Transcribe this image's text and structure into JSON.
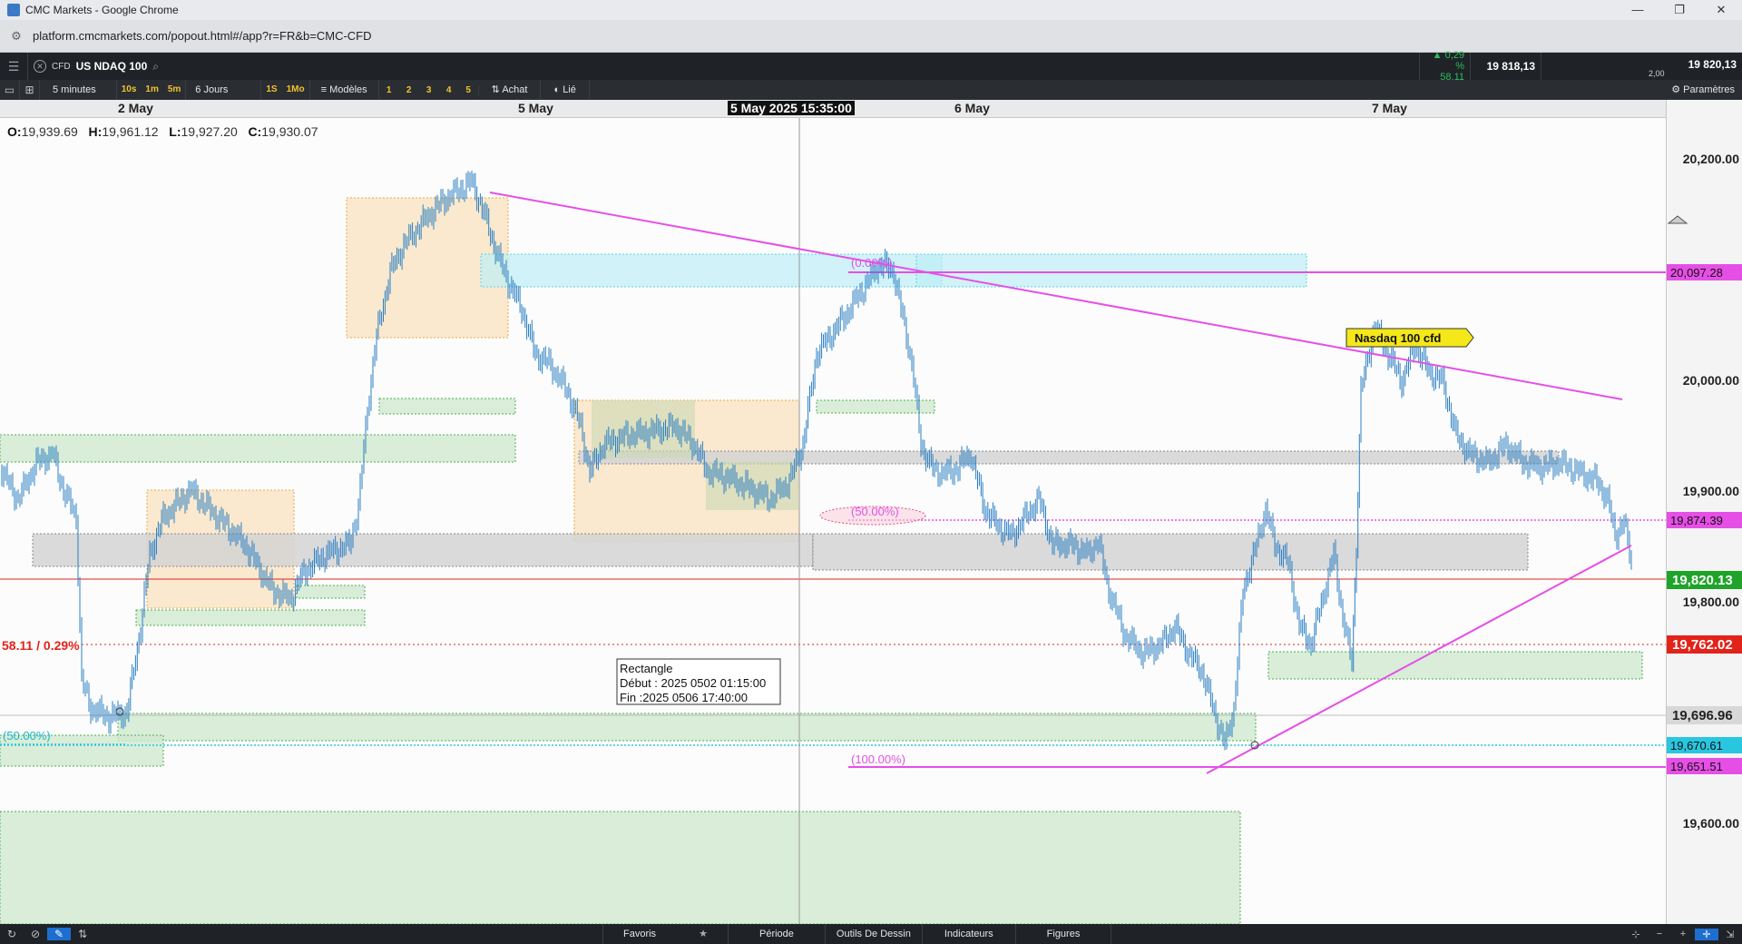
{
  "browser": {
    "window_title": "CMC Markets - Google Chrome",
    "url": "platform.cmcmarkets.com/popout.html#/app?r=FR&b=CMC-CFD",
    "controls": [
      "—",
      "❐",
      "✕"
    ]
  },
  "instrument": {
    "type": "CFD",
    "name": "US NDAQ 100",
    "change_pct": "▲ 0,29 %",
    "change_pts": "58,11",
    "bid": "19 818,13",
    "ask": "19 820,13",
    "spread": "2,00"
  },
  "toolbar": {
    "timeframe": "5 minutes",
    "quick_intervals": [
      "10s",
      "1m",
      "5m"
    ],
    "range": "6 Jours",
    "quick_ranges": [
      "1S",
      "1Mo"
    ],
    "models_label": "Modèles",
    "model_slots": [
      "1",
      "2",
      "3",
      "4",
      "5"
    ],
    "buy_label": "Achat",
    "link_label": "Lié",
    "settings_label": "Paramètres"
  },
  "date_axis": {
    "labels": [
      "2 May",
      "5 May",
      "6 May",
      "7 May"
    ],
    "cursor_label": "5 May 2025 15:35:00"
  },
  "ohlc": {
    "o_label": "O:",
    "o": "19,939.69",
    "h_label": "H:",
    "h": "19,961.12",
    "l_label": "L:",
    "l": "19,927.20",
    "c_label": "C:",
    "c": "19,930.07"
  },
  "price_axis": {
    "ticks": [
      "20,200.00",
      "20,000.00",
      "19,900.00",
      "19,800.00",
      "19,600.00"
    ],
    "tags": [
      {
        "label": "20,097.28",
        "color": "#e64fe6"
      },
      {
        "label": "19,874.39",
        "color": "#e64fe6"
      },
      {
        "label": "19,820.13",
        "color": "#1fa32a"
      },
      {
        "label": "19,762.02",
        "color": "#e2231a"
      },
      {
        "label": "19,696.96",
        "color": "#d8d8d8"
      },
      {
        "label": "19,670.61",
        "color": "#29c6e0"
      },
      {
        "label": "19,651.51",
        "color": "#e64fe6"
      }
    ]
  },
  "annotations": {
    "fib_0": "(0.00%)",
    "fib_50": "(50.00%)",
    "fib_100": "(100.00%)",
    "fib_50_left": "(50.00%)",
    "change_label": "58.11 / 0.29%",
    "instrument_tag": "Nasdaq 100  cfd",
    "tooltip_title": "Rectangle",
    "tooltip_start": "Début : 2025 0502 01:15:00",
    "tooltip_end": "Fin :2025 0506 17:40:00"
  },
  "bottom_bar": {
    "tabs": [
      "Favoris",
      "Période",
      "Outils De Dessin",
      "Indicateurs",
      "Figures"
    ]
  },
  "colors": {
    "candle": "#2b7fc3",
    "trend": "#e64fe6",
    "zone_orange": "#f7d9a8",
    "zone_green": "#cfe8cf",
    "zone_grey": "#d4d4d4",
    "zone_cyan": "#bdeef6",
    "current_price": "#e2231a"
  }
}
